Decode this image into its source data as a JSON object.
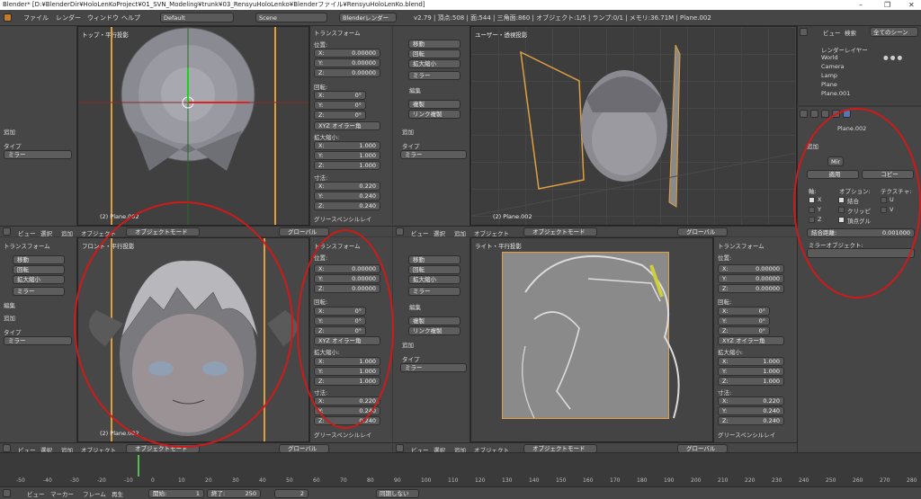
{
  "window": {
    "title": "Blender* [D:¥BlenderDir¥HoloLenKoProject¥01_SVN_Modeling¥trunk¥03_RensyuHoloLenko¥Blenderファイル¥RensyuHoloLenKo.blend]",
    "controls": [
      "–",
      "❐",
      "✕"
    ]
  },
  "info_header": {
    "menus": [
      "ファイル",
      "レンダー",
      "ウィンドウ",
      "ヘルプ"
    ],
    "layout": "Default",
    "scene": "Scene",
    "engine": "Blenderレンダー",
    "stats": "v2.79 | 頂点:508 | 面:544 | 三角面:860 | オブジェクト:1/5 | ランプ:0/1 | メモリ:36.71M | Plane.002"
  },
  "viewports": {
    "top_left": {
      "label": "トップ・平行投影",
      "object": "(2) Plane.002"
    },
    "top_right": {
      "label": "ユーザー・透視投影",
      "object": "(2) Plane.002"
    },
    "bottom_left": {
      "label": "フロント・平行投影",
      "object": "(2) Plane.002"
    },
    "bottom_right": {
      "label": "ライト・平行投影",
      "object": ""
    }
  },
  "toolshelf": {
    "top_left": {
      "add": "追加",
      "type_label": "タイプ",
      "type_value": "ミラー"
    },
    "top_right": {
      "buttons": [
        "移動",
        "回転",
        "拡大縮小",
        "ミラー"
      ],
      "edit": "編集",
      "edit_buttons": [
        "複製",
        "リンク複製"
      ],
      "add": "追加",
      "type_label": "タイプ",
      "type_value": "ミラー"
    },
    "bottom_left": {
      "title": "トランスフォーム",
      "buttons": [
        "移動",
        "回転",
        "拡大縮小",
        "ミラー"
      ],
      "edit": "編集",
      "add": "追加",
      "type_label": "タイプ",
      "type_value": "ミラー"
    },
    "bottom_right": {
      "buttons": [
        "移動",
        "回転",
        "拡大縮小",
        "ミラー"
      ],
      "edit": "編集",
      "edit_buttons": [
        "複製",
        "リンク複製"
      ],
      "add": "追加",
      "type_label": "タイプ",
      "type_value": "ミラー"
    }
  },
  "transform": {
    "title": "トランスフォーム",
    "location_label": "位置:",
    "location": [
      {
        "axis": "X:",
        "value": "0.00000"
      },
      {
        "axis": "Y:",
        "value": "0.00000"
      },
      {
        "axis": "Z:",
        "value": "0.00000"
      }
    ],
    "rotation_label": "回転:",
    "rotation": [
      {
        "axis": "X:",
        "value": "0°"
      },
      {
        "axis": "Y:",
        "value": "0°"
      },
      {
        "axis": "Z:",
        "value": "0°"
      }
    ],
    "rotation_mode": "XYZ オイラー角",
    "scale_label": "拡大縮小:",
    "scale": [
      {
        "axis": "X:",
        "value": "1.000"
      },
      {
        "axis": "Y:",
        "value": "1.000"
      },
      {
        "axis": "Z:",
        "value": "1.000"
      }
    ],
    "dimensions_label": "寸法:",
    "dimensions": [
      {
        "axis": "X:",
        "value": "0.220"
      },
      {
        "axis": "Y:",
        "value": "0.240"
      },
      {
        "axis": "Z:",
        "value": "0.240"
      }
    ],
    "grease": "グリースペンシルレイ"
  },
  "viewport_header": {
    "menus": [
      "ビュー",
      "選択",
      "追加",
      "オブジェクト"
    ],
    "mode": "オブジェクトモード",
    "orientation": "グローバル"
  },
  "outliner": {
    "menus": [
      "ビュー",
      "検索"
    ],
    "filter": "全てのシーン",
    "items": [
      "レンダーレイヤー",
      "World",
      "Camera",
      "Lamp",
      "Plane",
      "Plane.001"
    ]
  },
  "modifier": {
    "object": "Plane.002",
    "add": "追加",
    "name": "Mir",
    "apply": "適用",
    "copy": "コピー",
    "axis_label": "軸:",
    "options_label": "オプション:",
    "texture_label": "テクスチャ:",
    "axis": [
      {
        "name": "X",
        "checked": true
      },
      {
        "name": "Y",
        "checked": false
      },
      {
        "name": "Z",
        "checked": false
      }
    ],
    "options": [
      {
        "name": "結合",
        "checked": true
      },
      {
        "name": "クリッピ",
        "checked": false
      },
      {
        "name": "頂点グル",
        "checked": true
      }
    ],
    "texture": [
      "U",
      "V"
    ],
    "merge_label": "結合距離:",
    "merge_value": "0.001000",
    "mirror_object_label": "ミラーオブジェクト:"
  },
  "timeline": {
    "ticks": [
      "-50",
      "-40",
      "-30",
      "-20",
      "-10",
      "0",
      "10",
      "20",
      "30",
      "40",
      "50",
      "60",
      "70",
      "80",
      "90",
      "100",
      "110",
      "120",
      "130",
      "140",
      "150",
      "160",
      "170",
      "180",
      "190",
      "200",
      "210",
      "220",
      "230",
      "240",
      "250",
      "260",
      "270",
      "280"
    ],
    "menus": [
      "ビュー",
      "マーカー",
      "フレーム",
      "再生"
    ],
    "start_label": "開始:",
    "start": "1",
    "end_label": "終了:",
    "end": "250",
    "current": "2",
    "sync": "同期しない"
  },
  "colors": {
    "annotation": "#d01a1a",
    "selection": "#e0a040",
    "bg": "#393939"
  }
}
